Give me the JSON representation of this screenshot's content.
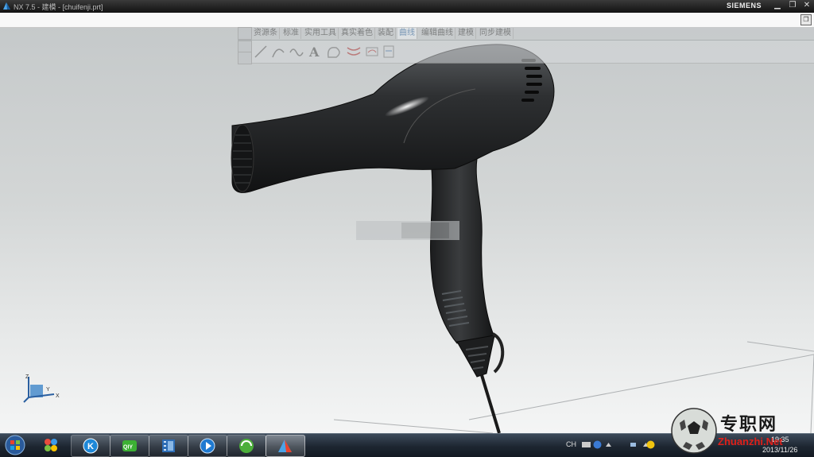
{
  "window": {
    "title": "NX 7.5 - 建模 - [chuifenji.prt]",
    "brand": "SIEMENS",
    "minimize": "▁",
    "restore": "❐",
    "close": "✕"
  },
  "toolbar": {
    "tabs": [
      {
        "label": "资源条"
      },
      {
        "label": "标准"
      },
      {
        "label": "实用工具"
      },
      {
        "label": "真实着色"
      },
      {
        "label": "装配"
      },
      {
        "label": "曲线",
        "active": true
      },
      {
        "label": "编辑曲线"
      },
      {
        "label": "建模"
      },
      {
        "label": "同步建模"
      }
    ],
    "icons": [
      "line-icon",
      "arc-icon",
      "spline-icon",
      "text-icon",
      "curve-region-icon",
      "offset-curve-icon",
      "project-curve-icon",
      "extract-curve-icon"
    ],
    "text_tool_glyph": "A"
  },
  "viewport": {
    "model": "hair-dryer",
    "triad_labels": {
      "z": "Z",
      "y": "Y",
      "x": "X"
    },
    "background_top": "#c4c8c9",
    "background_bottom": "#f4f5f5"
  },
  "taskbar": {
    "apps": [
      {
        "name": "start-orb"
      },
      {
        "name": "app-launcher"
      },
      {
        "name": "kugou-music",
        "glyph": "K"
      },
      {
        "name": "iqiyi-player",
        "glyph": "QIY"
      },
      {
        "name": "video-editor"
      },
      {
        "name": "media-player"
      },
      {
        "name": "browser"
      },
      {
        "name": "siemens-nx",
        "active": true
      }
    ],
    "tray": {
      "language": "CH",
      "time": "19:35",
      "date": "2013/11/26"
    }
  },
  "watermark": {
    "text_cn": "专职网",
    "url": "Zhuanzhi.Net"
  },
  "colors": {
    "title_bar": "#1c1c1c",
    "active_tab": "#3a6ea5",
    "watermark_red": "#e0201a"
  }
}
